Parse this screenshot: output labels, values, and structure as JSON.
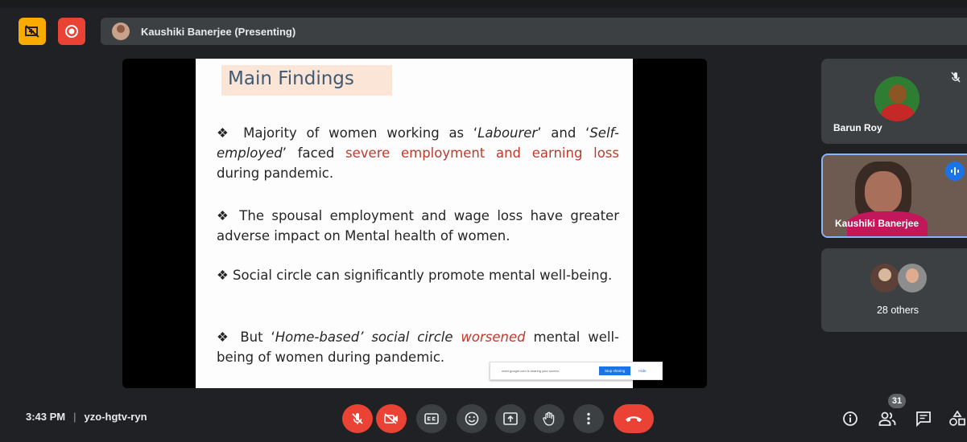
{
  "topbar": {
    "presenter_label": "Kaushiki Banerjee (Presenting)"
  },
  "slide": {
    "title": "Main Findings",
    "bullets": [
      {
        "symbol": "❖",
        "parts": [
          {
            "text": " Majority of women working as ‘"
          },
          {
            "text": "Labourer",
            "italic": true
          },
          {
            "text": "’ and ‘"
          },
          {
            "text": "Self-employed",
            "italic": true
          },
          {
            "text": "’ faced "
          },
          {
            "text": "severe employment and earning loss",
            "color": "#c0392b"
          },
          {
            "text": " during pandemic."
          }
        ]
      },
      {
        "symbol": "❖",
        "parts": [
          {
            "text": "  The spousal employment and wage loss have greater adverse impact on Mental health of women."
          }
        ]
      },
      {
        "symbol": "❖",
        "parts": [
          {
            "text": "  Social circle can significantly promote mental well-being."
          }
        ]
      },
      {
        "symbol": "❖",
        "parts": [
          {
            "text": "  But ‘"
          },
          {
            "text": "Home-based’ social circle",
            "italic": true
          },
          {
            "text": "  "
          },
          {
            "text": "worsened",
            "italic": true,
            "color": "#c0392b"
          },
          {
            "text": " mental well-being of women during pandemic."
          }
        ]
      }
    ],
    "share_notice": {
      "text": "meet.google.com is sharing your screen.",
      "stop_label": "Stop sharing",
      "hide_label": "Hide"
    }
  },
  "participants": [
    {
      "name": "Barun Roy",
      "muted": true
    },
    {
      "name": "Kaushiki Banerjee",
      "speaking": true
    },
    {
      "name": "28 others"
    }
  ],
  "bottombar": {
    "time": "3:43 PM",
    "separator": "|",
    "meeting_code": "yzo-hgtv-ryn",
    "people_count": "31"
  },
  "colors": {
    "background": "#202124",
    "danger": "#ea4335",
    "warning": "#f9ab00",
    "accent": "#1a73e8",
    "slide_title": "#3e5a74",
    "slide_highlight": "#c0392b"
  },
  "icons": {
    "top_left": [
      "present-off-icon",
      "record-icon"
    ],
    "controls": [
      "mic-off-icon",
      "camera-off-icon",
      "captions-icon",
      "emoji-icon",
      "present-icon",
      "raise-hand-icon",
      "more-options-icon",
      "end-call-icon"
    ],
    "right_controls": [
      "info-icon",
      "people-icon",
      "chat-icon",
      "activities-icon"
    ]
  }
}
